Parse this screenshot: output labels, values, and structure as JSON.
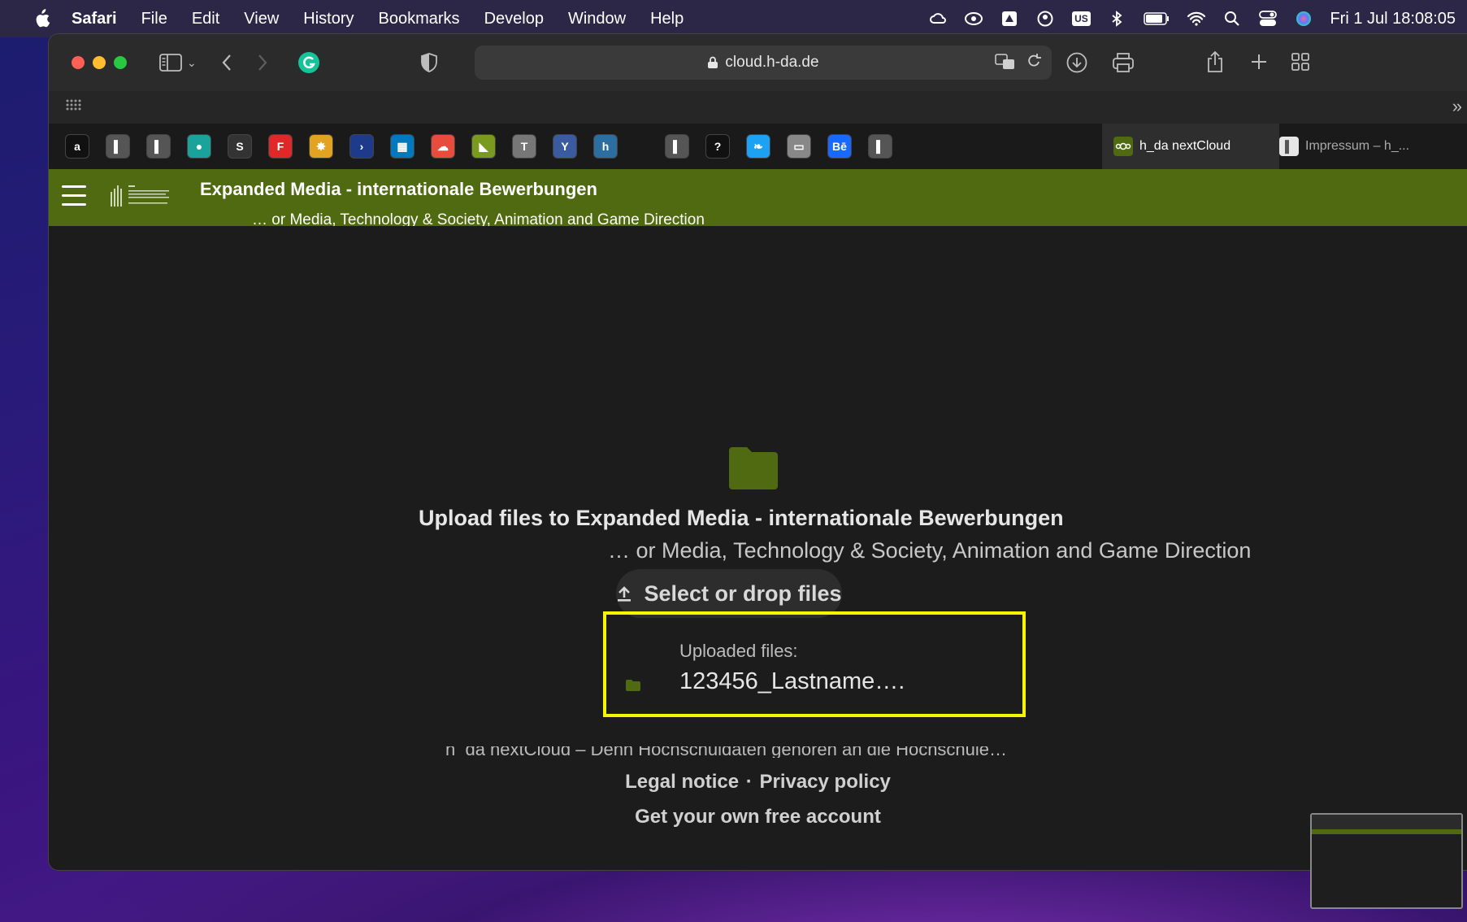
{
  "menubar": {
    "app": "Safari",
    "items": [
      "File",
      "Edit",
      "View",
      "History",
      "Bookmarks",
      "Develop",
      "Window",
      "Help"
    ],
    "status_icons": [
      "creative-cloud-icon",
      "creative-cloud-sync-icon",
      "drive-icon",
      "user-icon",
      "input-source-icon",
      "bluetooth-icon",
      "battery-icon",
      "wifi-icon",
      "spotlight-icon",
      "control-center-icon",
      "siri-icon"
    ],
    "input_source": "US",
    "clock": "Fri 1 Jul  18:08:05"
  },
  "browser": {
    "url": "cloud.h-da.de",
    "tabs": [
      {
        "label": "h_da nextCloud",
        "active": true
      },
      {
        "label": "Impressum – h_...",
        "active": false
      }
    ],
    "bookmarks": [
      {
        "icon": "amazon-icon",
        "glyph": "a",
        "color": "#111111"
      },
      {
        "icon": "hda-icon",
        "glyph": "▌",
        "color": "#555555"
      },
      {
        "icon": "hda-icon",
        "glyph": "▌",
        "color": "#555555"
      },
      {
        "icon": "meet-icon",
        "glyph": "●",
        "color": "#1aa39a"
      },
      {
        "icon": "s-icon",
        "glyph": "S",
        "color": "#333333"
      },
      {
        "icon": "flipboard-icon",
        "glyph": "F",
        "color": "#e12828"
      },
      {
        "icon": "puzzle-icon",
        "glyph": "✸",
        "color": "#e2a321"
      },
      {
        "icon": "chevron-icon",
        "glyph": "›",
        "color": "#1e3a8a"
      },
      {
        "icon": "trello-icon",
        "glyph": "▦",
        "color": "#0079bf"
      },
      {
        "icon": "clouds-icon",
        "glyph": "☁",
        "color": "#e74c3c"
      },
      {
        "icon": "green-flag-icon",
        "glyph": "◣",
        "color": "#7a9a1e"
      },
      {
        "icon": "t-icon",
        "glyph": "T",
        "color": "#777777"
      },
      {
        "icon": "y-icon",
        "glyph": "Y",
        "color": "#3a5ba0"
      },
      {
        "icon": "h-icon",
        "glyph": "h",
        "color": "#2c6ea0"
      },
      {
        "icon": "hda-icon",
        "glyph": "▌",
        "color": "#555555"
      },
      {
        "icon": "question-icon",
        "glyph": "?",
        "color": "#111111"
      },
      {
        "icon": "twitter-icon",
        "glyph": "❧",
        "color": "#1da1f2"
      },
      {
        "icon": "card-icon",
        "glyph": "▭",
        "color": "#888888"
      },
      {
        "icon": "behance-icon",
        "glyph": "Bē",
        "color": "#1769ff"
      },
      {
        "icon": "hda-icon",
        "glyph": "▌",
        "color": "#555555"
      }
    ]
  },
  "nextcloud": {
    "header_title": "Expanded Media - internationale Bewerbungen",
    "header_subtitle": "… or Media, Technology & Society, Animation and Game Direction",
    "upload_title": "Upload files to Expanded Media - internationale Bewerbungen",
    "upload_subtitle": "… or Media, Technology & Society, Animation and Game Direction",
    "select_button": "Select or drop files",
    "uploaded_label": "Uploaded files:",
    "uploaded_file": "123456_Lastname….",
    "footer_tagline": "h_da nextCloud – Denn Hochschuldaten gehören an die Hochschule…",
    "footer_legal": "Legal notice",
    "footer_separator": "·",
    "footer_privacy": "Privacy policy",
    "footer_account": "Get your own free account"
  },
  "colors": {
    "header_green": "#4f6a10",
    "folder_green": "#4f6a10",
    "highlight_yellow": "#f5f500"
  }
}
